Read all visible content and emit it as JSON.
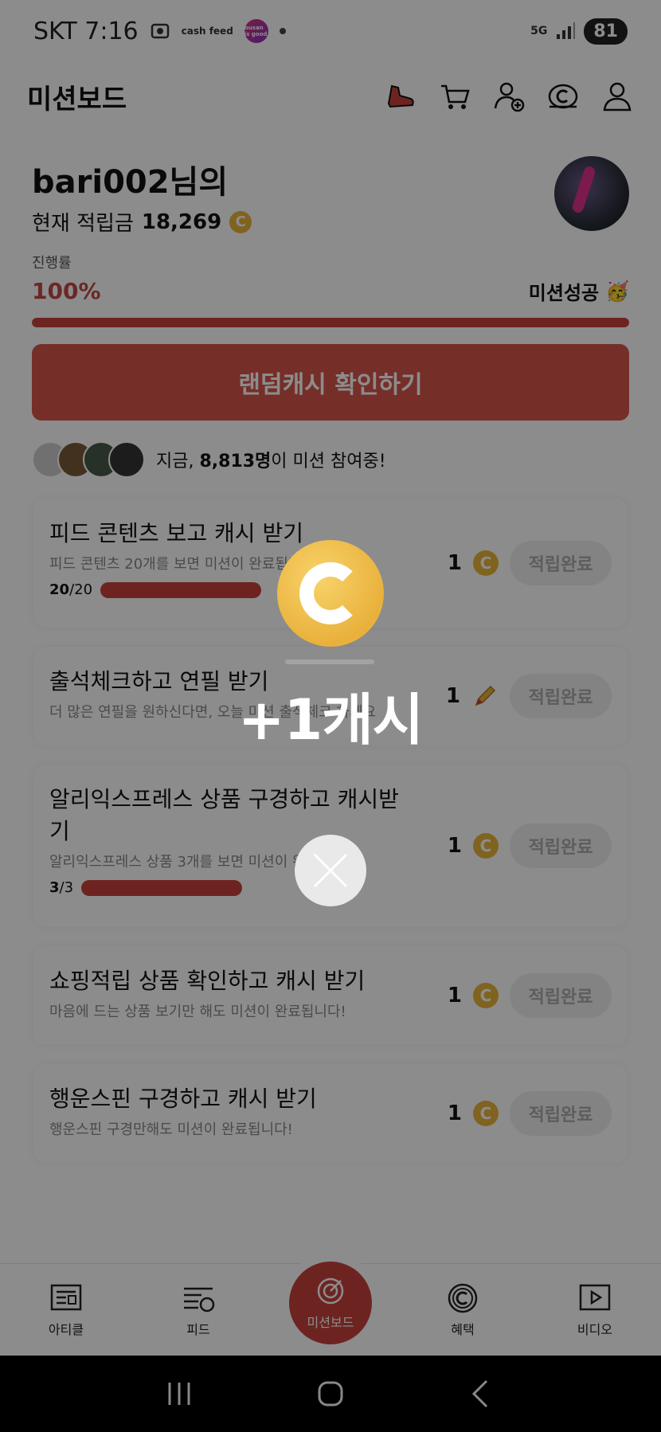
{
  "status_bar": {
    "carrier_time": "SKT 7:16",
    "app_badge_1": "cash feed",
    "app_badge_2": "busan is good",
    "network": "5G",
    "battery": "81"
  },
  "header": {
    "title": "미션보드",
    "icons": [
      "shoe-icon",
      "cart-icon",
      "add-friend-icon",
      "cash-icon",
      "profile-icon"
    ]
  },
  "profile": {
    "name": "bari002님의",
    "points_label": "현재 적립금",
    "points_value": "18,269"
  },
  "progress": {
    "label": "진행률",
    "value_text": "100%",
    "fraction": 1.0,
    "status": "미션성공",
    "status_emoji": "🥳"
  },
  "random_cash_button": "랜덤캐시 확인하기",
  "participants": {
    "prefix": "지금, ",
    "count": "8,813명",
    "suffix": "이 미션 참여중!"
  },
  "missions": [
    {
      "title": "피드 콘텐츠 보고 캐시 받기",
      "desc": "피드 콘텐츠 20개를 보면 미션이 완료됩니다!",
      "progress_done": "20",
      "progress_total": "/20",
      "reward": "1",
      "reward_type": "cash-coin-icon",
      "button": "적립완료"
    },
    {
      "title": "출석체크하고 연필 받기",
      "desc": "더 많은 연필을 원하신다면, 오늘 미션 출석체크 하세요",
      "reward": "1",
      "reward_type": "pencil-icon",
      "button": "적립완료"
    },
    {
      "title": "알리익스프레스 상품 구경하고 캐시받기",
      "desc": "알리익스프레스 상품 3개를 보면 미션이 완료됩니다!",
      "progress_done": "3",
      "progress_total": "/3",
      "reward": "1",
      "reward_type": "cash-coin-icon",
      "button": "적립완료"
    },
    {
      "title": "쇼핑적립 상품 확인하고 캐시 받기",
      "desc": "마음에 드는 상품 보기만 해도 미션이 완료됩니다!",
      "reward": "1",
      "reward_type": "cash-coin-icon",
      "button": "적립완료"
    },
    {
      "title": "행운스핀 구경하고 캐시 받기",
      "desc": "행운스핀 구경만해도 미션이 완료됩니다!",
      "reward": "1",
      "reward_type": "cash-coin-icon",
      "button": "적립완료"
    }
  ],
  "bottom_nav": {
    "items": [
      "아티클",
      "피드",
      "미션보드",
      "혜택",
      "비디오"
    ]
  },
  "overlay": {
    "reward_text": "+1캐시"
  },
  "colors": {
    "accent": "#c7433d",
    "coin": "#e9b13c"
  }
}
